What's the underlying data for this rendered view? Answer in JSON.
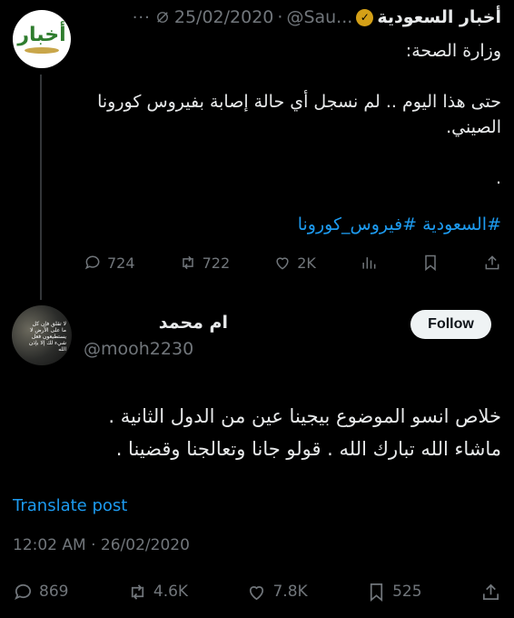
{
  "tweet1": {
    "author_name": "أخبار السعودية",
    "handle": "@Sau...",
    "separator": "·",
    "date": "25/02/2020",
    "more": "···",
    "avatar_logo_text": "أخبار",
    "body": [
      "وزارة الصحة:",
      "",
      "حتى هذا اليوم .. لم نسجل أي حالة إصابة بفيروس كورونا الصيني.",
      "",
      "."
    ],
    "hashtags": "#السعودية #فيروس_كورونا",
    "replies": "724",
    "retweets": "722",
    "likes": "2K",
    "icons": [
      "reply-icon",
      "retweet-icon",
      "like-icon",
      "views-icon",
      "bookmark-icon",
      "share-icon"
    ]
  },
  "tweet2": {
    "author_name": "ام محمد",
    "handle": "@mooh2230",
    "follow_label": "Follow",
    "avatar_text": "لا تقلق فإن كل ما على الأرض لا يستطيعون فعل شيء لك إلا بإذن الله",
    "body": [
      "خلاص انسو الموضوع بيجينا عين من الدول الثانية .",
      "ماشاء الله تبارك الله . قولو جانا وتعالجنا وقضينا ."
    ],
    "translate_label": "Translate post",
    "timestamp": "12:02 AM · 26/02/2020",
    "replies": "869",
    "retweets": "4.6K",
    "likes": "7.8K",
    "bookmarks": "525"
  },
  "colors": {
    "background": "#000000",
    "text": "#e7e9ea",
    "muted": "#71767b",
    "link": "#1d9bf0",
    "verified": "#d4a017"
  }
}
